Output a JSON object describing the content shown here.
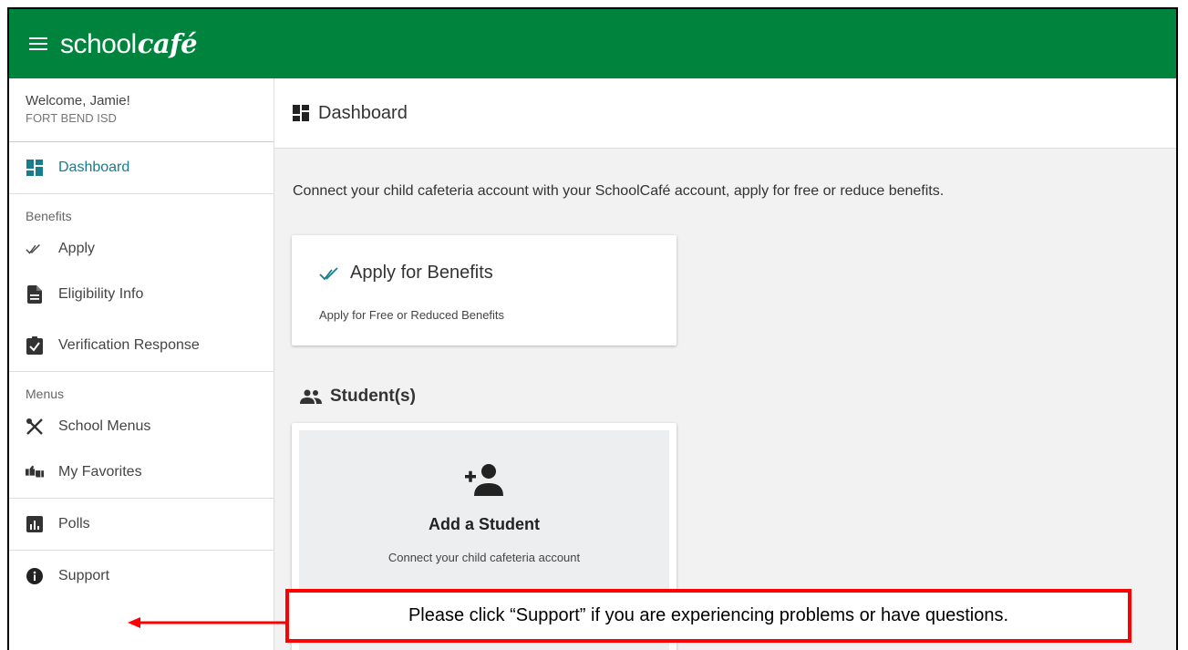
{
  "app": {
    "logo_text": "school",
    "logo_bold": "café"
  },
  "sidebar": {
    "welcome": "Welcome, Jamie!",
    "district": "FORT BEND ISD",
    "dashboard": "Dashboard",
    "benefits_section": "Benefits",
    "apply": "Apply",
    "eligibility": "Eligibility Info",
    "verification": "Verification Response",
    "menus_section": "Menus",
    "school_menus": "School Menus",
    "favorites": "My Favorites",
    "polls": "Polls",
    "support": "Support"
  },
  "main": {
    "title": "Dashboard",
    "intro": "Connect your child cafeteria account with your SchoolCafé account, apply for free or reduce benefits.",
    "apply_card": {
      "title": "Apply for Benefits",
      "subtitle": "Apply for Free or Reduced Benefits"
    },
    "students_heading": "Student(s)",
    "add_student": {
      "title": "Add a Student",
      "subtitle": "Connect your child cafeteria account"
    }
  },
  "callout": {
    "text": "Please click “Support” if you are experiencing problems or have questions."
  },
  "colors": {
    "brand": "#00843d",
    "accent": "#177c8c",
    "callout": "#ff0000"
  }
}
